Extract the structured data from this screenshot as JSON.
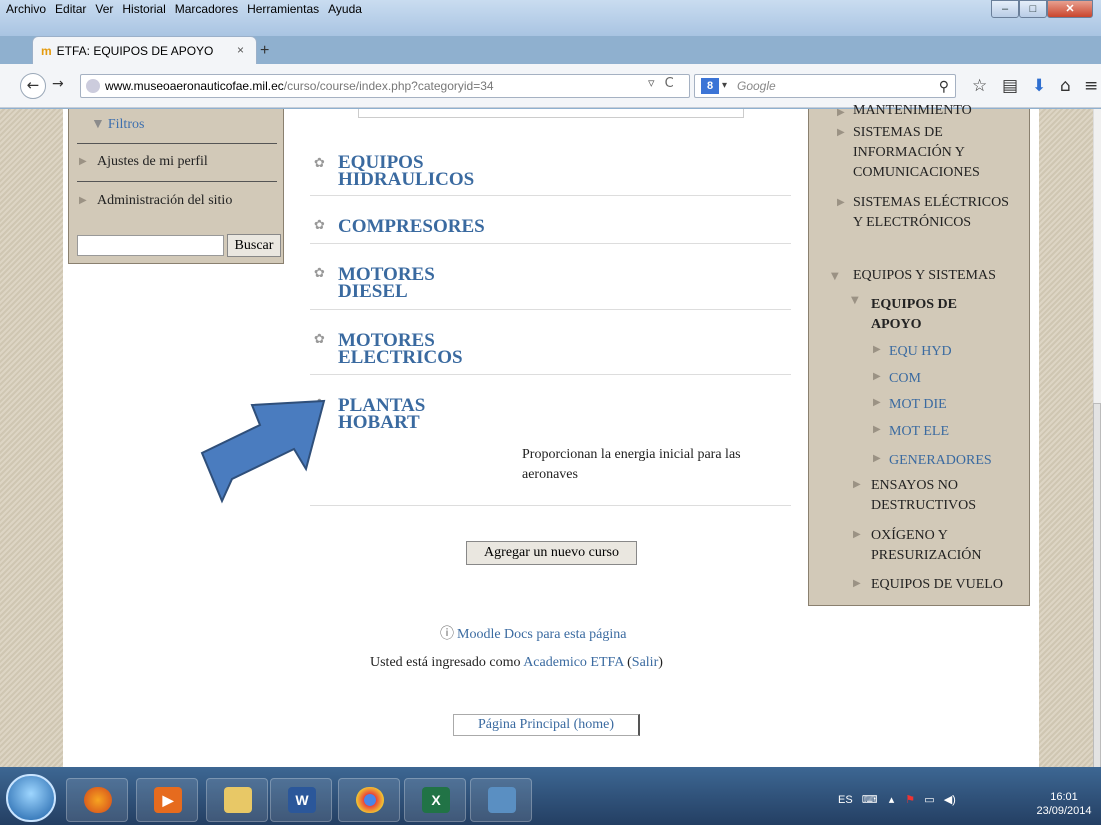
{
  "menubar": [
    "Archivo",
    "Editar",
    "Ver",
    "Historial",
    "Marcadores",
    "Herramientas",
    "Ayuda"
  ],
  "tab": {
    "title": "ETFA: EQUIPOS DE APOYO",
    "close": "×",
    "new": "+"
  },
  "url": {
    "host": "www.museoaeronauticofae.mil.ec",
    "path": "/curso/course/index.php?categoryid=34"
  },
  "search": {
    "placeholder": "Google"
  },
  "left_block": {
    "filtros": "Filtros",
    "items": [
      "Ajustes de mi perfil",
      "Administración del sitio"
    ],
    "search_button": "Buscar"
  },
  "categories": [
    {
      "name": "EQUIPOS HIDRAULICOS"
    },
    {
      "name": "COMPRESORES"
    },
    {
      "name": "MOTORES DIESEL"
    },
    {
      "name": "MOTORES ELECTRICOS"
    },
    {
      "name": "PLANTAS HOBART"
    }
  ],
  "description": "Proporcionan la energia inicial para las aeronaves",
  "add_course": "Agregar un nuevo curso",
  "footer": {
    "docs": "Moodle Docs para esta página",
    "logged_prefix": "Usted está ingresado como ",
    "user": "Academico ETFA",
    "logout": "Salir",
    "home": "Página Principal (home)"
  },
  "right_block": {
    "mantenimiento": "MANTENIMIENTO",
    "sistemas_info": "SISTEMAS DE INFORMACIÓN Y COMUNICACIONES",
    "sistemas_elec": "SISTEMAS ELÉCTRICOS Y ELECTRÓNICOS",
    "equipos_sistemas": "EQUIPOS Y SISTEMAS",
    "equipos_apoyo": "EQUIPOS DE APOYO",
    "sub": [
      "EQU HYD",
      "COM",
      "MOT DIE",
      "MOT ELE",
      "GENERADORES"
    ],
    "ensayos": "ENSAYOS NO DESTRUCTIVOS",
    "oxigeno": "OXÍGENO Y PRESURIZACIÓN",
    "vuelo": "EQUIPOS DE VUELO"
  },
  "tray": {
    "lang": "ES",
    "time": "16:01",
    "date": "23/09/2014"
  }
}
